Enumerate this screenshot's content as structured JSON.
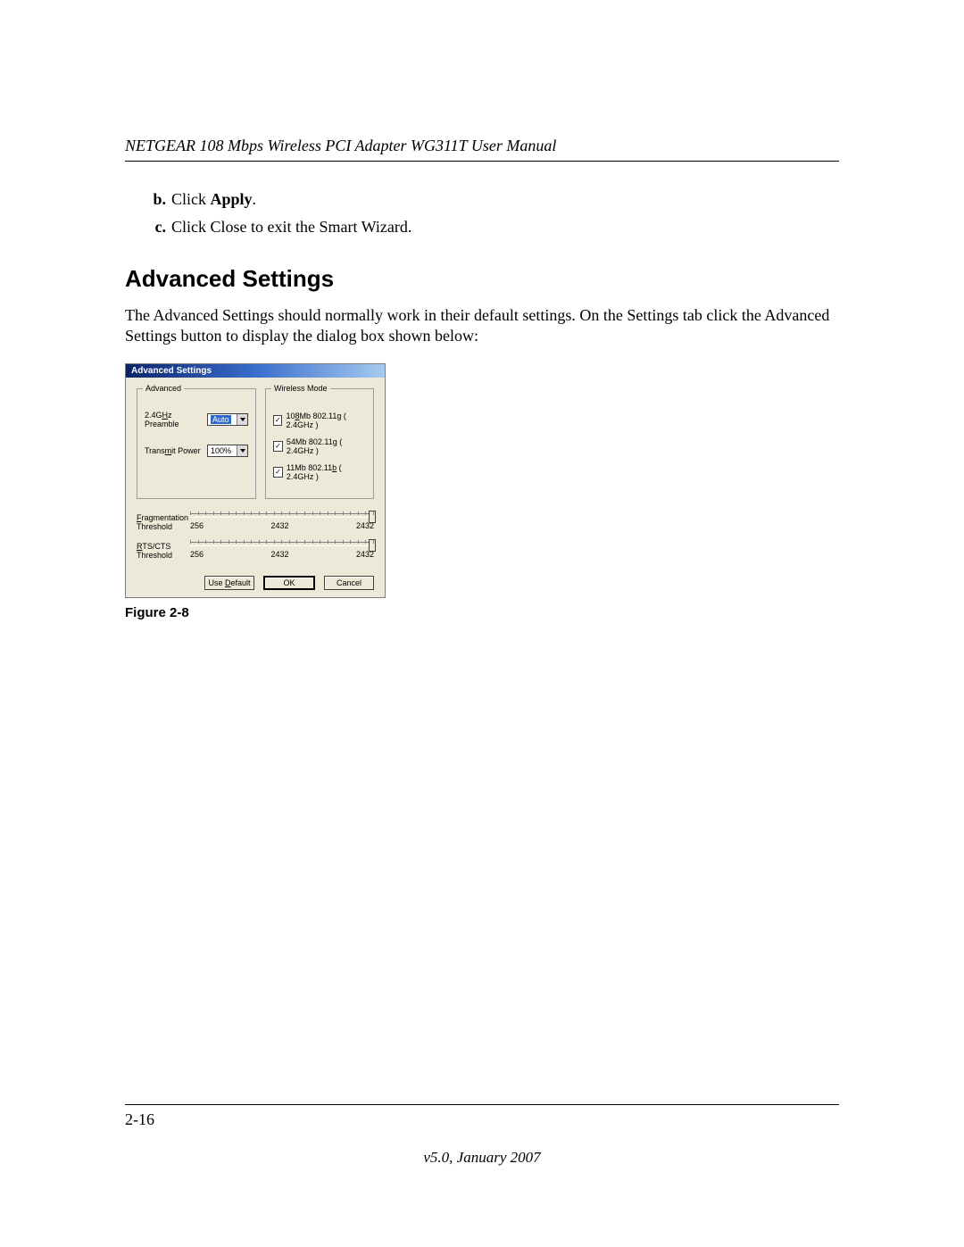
{
  "header": {
    "title": "NETGEAR 108 Mbps Wireless PCI Adapter WG311T User Manual"
  },
  "steps": {
    "b": {
      "marker": "b.",
      "prefix": "Click ",
      "bold": "Apply",
      "suffix": "."
    },
    "c": {
      "marker": "c.",
      "text": "Click Close to exit the Smart Wizard."
    }
  },
  "section": {
    "heading": "Advanced Settings",
    "paragraph": "The Advanced Settings should normally work in their default settings. On the Settings tab click the Advanced Settings button to display the dialog box shown below:"
  },
  "dialog": {
    "title": "Advanced Settings",
    "advanced": {
      "legend": "Advanced",
      "preamble_label": "2.4GHz Preamble",
      "preamble_value": "Auto",
      "power_label": "Transmit Power",
      "power_value": "100%"
    },
    "wireless": {
      "legend": "Wireless Mode",
      "modes": [
        "108Mb 802.11g ( 2.4GHz )",
        "54Mb 802.11g ( 2.4GHz )",
        "11Mb 802.11b ( 2.4GHz )"
      ]
    },
    "sliders": {
      "frag_label_line1": "Fragmentation",
      "frag_label_line2": "Threshold",
      "rts_label_line1": "RTS/CTS",
      "rts_label_line2": "Threshold",
      "min": "256",
      "mid": "2432",
      "max": "2432"
    },
    "buttons": {
      "defaultBtn": "Use Default",
      "ok": "OK",
      "cancel": "Cancel"
    }
  },
  "figure": {
    "caption": "Figure 2-8"
  },
  "footer": {
    "pageNumber": "2-16",
    "version": "v5.0, January 2007"
  }
}
